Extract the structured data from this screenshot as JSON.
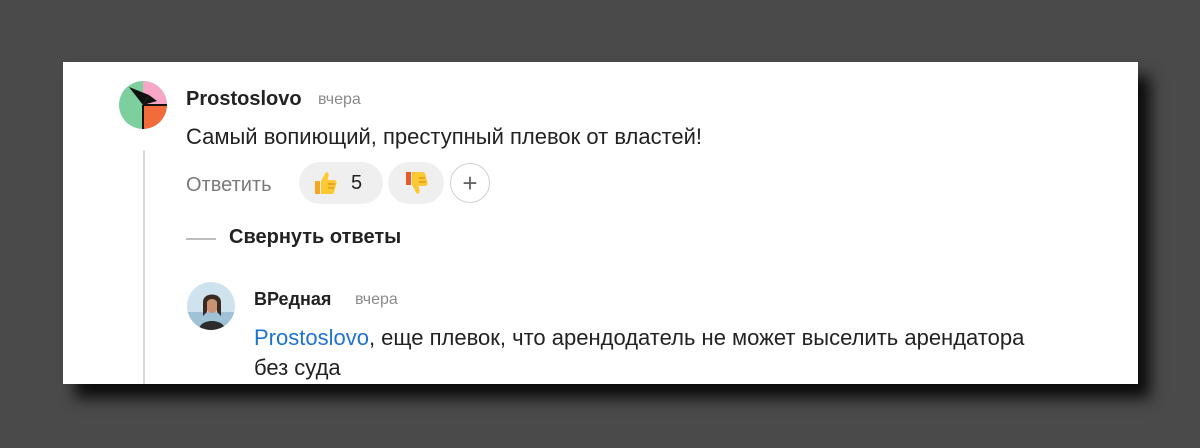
{
  "comment": {
    "author": "Prostoslovo",
    "time": "вчера",
    "text": "Самый вопиющий, преступный плевок от властей!",
    "reply_label": "Ответить",
    "likes_count": "5",
    "plus_label": "+",
    "like_icon": "thumbs-up-icon",
    "dislike_icon": "thumbs-down-icon"
  },
  "collapse_label": "Свернуть ответы",
  "reply": {
    "author": "ВРедная",
    "time": "вчера",
    "mention": "Prostoslovo",
    "text_line1": ", еще плевок, что арендодатель не может выселить арендатора",
    "text_line2": "без суда"
  },
  "colors": {
    "mention": "#1e73d2",
    "background": "#4a4a4a",
    "card": "#ffffff"
  }
}
